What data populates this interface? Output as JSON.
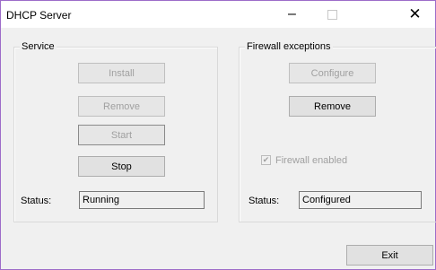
{
  "window": {
    "title": "DHCP Server",
    "minimize_glyph": "–",
    "close_glyph": "✕"
  },
  "service": {
    "legend": "Service",
    "install_label": "Install",
    "remove_label": "Remove",
    "start_label": "Start",
    "stop_label": "Stop",
    "status_label": "Status:",
    "status_value": "Running"
  },
  "firewall": {
    "legend": "Firewall exceptions",
    "configure_label": "Configure",
    "remove_label": "Remove",
    "enabled_label": "Firewall enabled",
    "enabled_checked": true,
    "check_glyph": "✔",
    "status_label": "Status:",
    "status_value": "Configured"
  },
  "footer": {
    "exit_label": "Exit"
  }
}
